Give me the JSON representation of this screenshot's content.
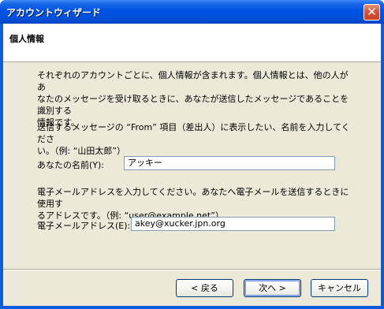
{
  "window": {
    "title": "アカウントウィザード"
  },
  "header": {
    "title": "個人情報"
  },
  "body": {
    "intro_line1": "それぞれのアカウントごとに、個人情報が含まれます。個人情報とは、他の人があ",
    "intro_line2": "なたのメッセージを受け取るときに、あなたが送信したメッセージであることを識別する",
    "intro_line3": "情報です。",
    "from_line1": "送信するメッセージの “From” 項目（差出人）に表示したい、名前を入力してくださ",
    "from_line2": "い。（例: “山田太郎”）",
    "email_line1": "電子メールアドレスを入力してください。あなたへ電子メールを送信するときに使用す",
    "email_line2": "るアドレスです。（例: “user@example.net”）"
  },
  "form": {
    "name_label": "あなたの名前(Y):",
    "name_value": "アッキー",
    "email_label": "電子メールアドレス(E):",
    "email_value": "akey@xucker.jpn.org"
  },
  "buttons": {
    "back": "< 戻る",
    "next": "次へ >",
    "cancel": "キャンセル"
  },
  "colors": {
    "titlebar": "#0054e3",
    "background": "#ece9d8",
    "close": "#d8553a"
  }
}
